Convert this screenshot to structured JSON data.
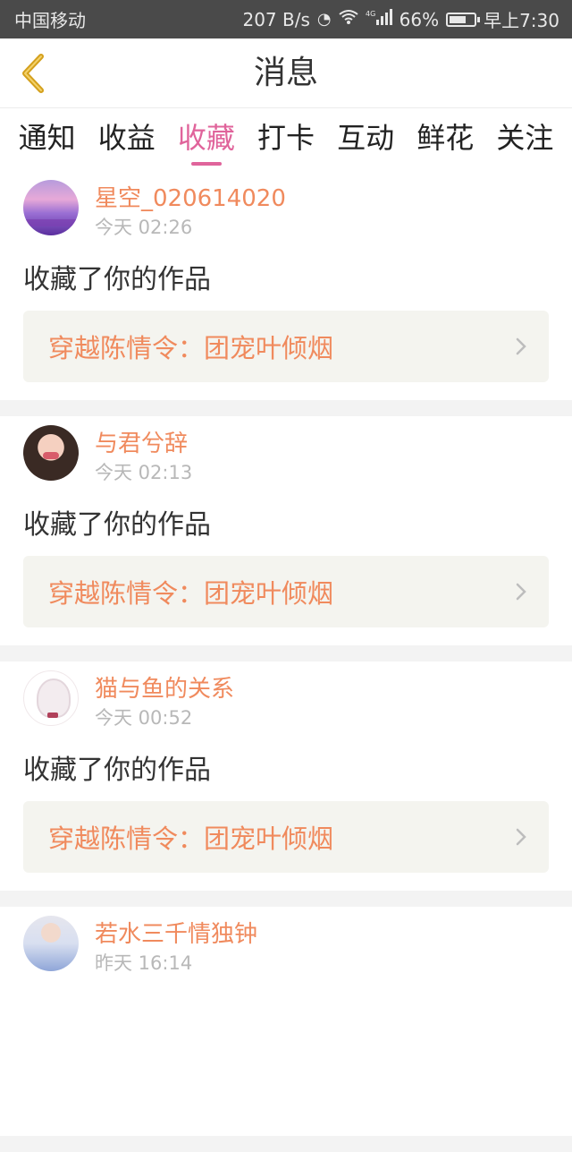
{
  "status_bar": {
    "carrier": "中国移动",
    "network_speed": "207 B/s",
    "network_type": "4G",
    "battery": "66%",
    "time": "早上7:30"
  },
  "nav": {
    "title": "消息",
    "back_icon": "chevron-left-icon"
  },
  "tabs": [
    {
      "label": "通知",
      "active": false
    },
    {
      "label": "收益",
      "active": false
    },
    {
      "label": "收藏",
      "active": true
    },
    {
      "label": "打卡",
      "active": false
    },
    {
      "label": "互动",
      "active": false
    },
    {
      "label": "鲜花",
      "active": false
    },
    {
      "label": "关注",
      "active": false
    }
  ],
  "messages": [
    {
      "username": "星空_020614020",
      "time": "今天 02:26",
      "action": "收藏了你的作品",
      "work_title": "穿越陈情令：团宠叶倾烟"
    },
    {
      "username": "与君兮辞",
      "time": "今天 02:13",
      "action": "收藏了你的作品",
      "work_title": "穿越陈情令：团宠叶倾烟"
    },
    {
      "username": "猫与鱼的关系",
      "time": "今天 00:52",
      "action": "收藏了你的作品",
      "work_title": "穿越陈情令：团宠叶倾烟"
    },
    {
      "username": "若水三千情独钟",
      "time": "昨天 16:14",
      "action": "",
      "work_title": ""
    }
  ],
  "colors": {
    "accent_pink": "#e0649b",
    "username_orange": "#f08a5d",
    "back_arrow": "#d4a01c"
  }
}
